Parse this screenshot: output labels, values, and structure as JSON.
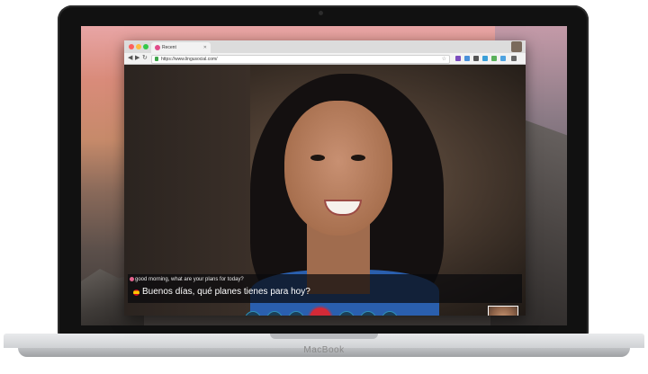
{
  "device": {
    "brand_label": "MacBook"
  },
  "browser": {
    "tab_title": "Recent",
    "url": "https://www.lingusocial.com/"
  },
  "call": {
    "original_text": "good morning, what are your plans for today?",
    "translated_text": "Buenos días, qué planes tienes para hoy?",
    "controls": [
      "camera-icon",
      "video-off-icon",
      "microphone-icon",
      "chat-icon",
      "play-icon",
      "hangup-icon"
    ],
    "colors": {
      "mic_active": "#d32a37",
      "control_accent": "#3cb4e0"
    }
  }
}
